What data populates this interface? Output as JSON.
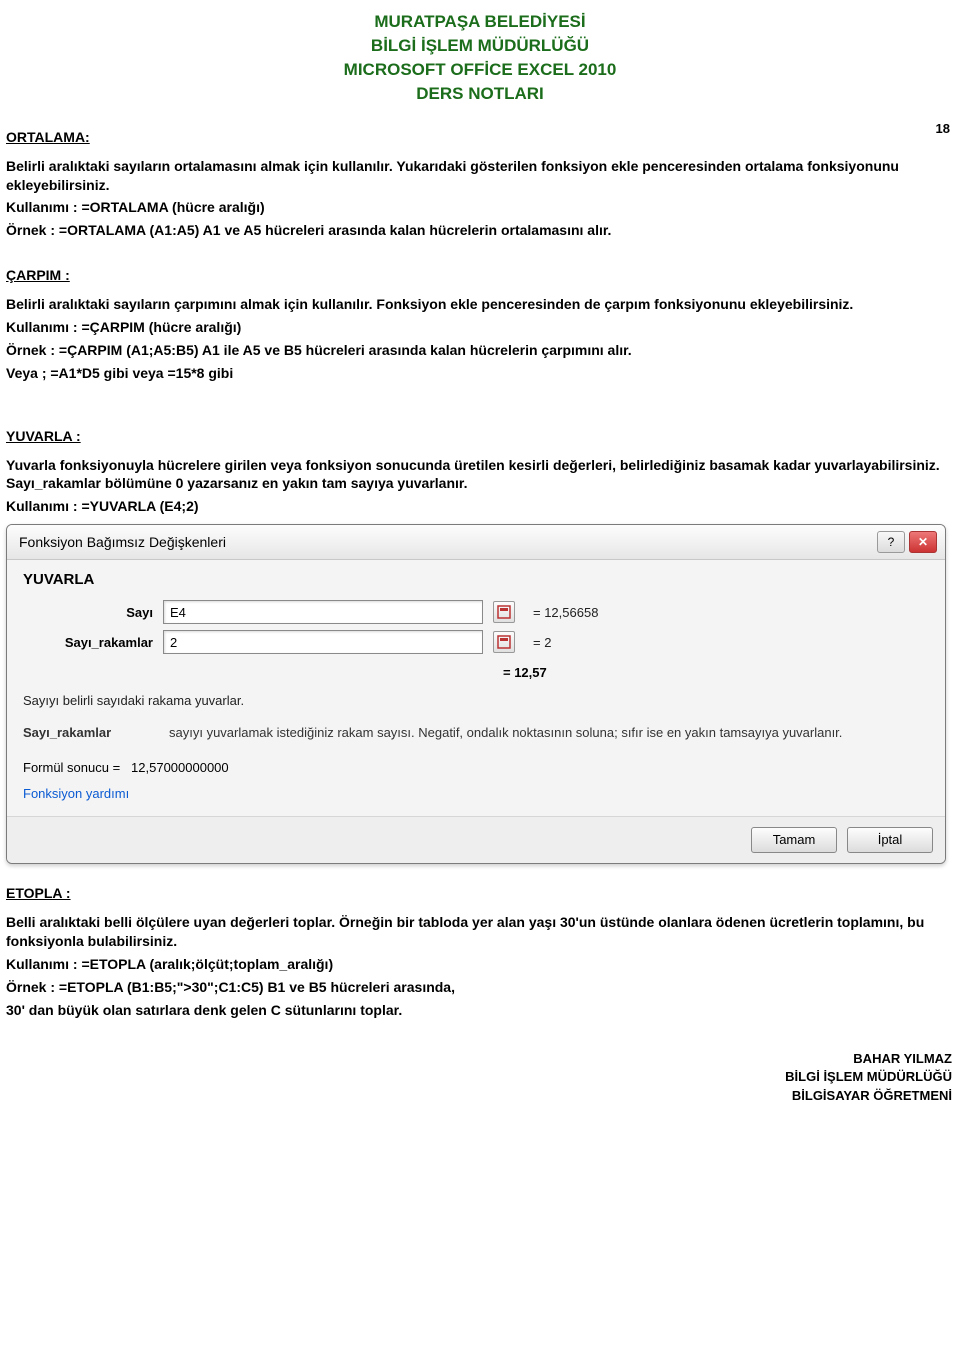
{
  "header": {
    "lines": [
      "MURATPAŞA BELEDİYESİ",
      "BİLGİ İŞLEM MÜDÜRLÜĞÜ",
      "MICROSOFT OFFİCE EXCEL 2010",
      "DERS NOTLARI"
    ]
  },
  "page_number": "18",
  "sections": {
    "ortalama": {
      "title": "ORTALAMA:",
      "p1": "Belirli aralıktaki sayıların ortalamasını almak için kullanılır. Yukarıdaki gösterilen fonksiyon ekle penceresinden ortalama fonksiyonunu ekleyebilirsiniz.",
      "p2": "Kullanımı : =ORTALAMA (hücre aralığı)",
      "p3": "Örnek : =ORTALAMA (A1:A5) A1 ve A5 hücreleri arasında kalan hücrelerin ortalamasını alır."
    },
    "carpim": {
      "title": "ÇARPIM :",
      "p1": "Belirli aralıktaki sayıların çarpımını almak için kullanılır. Fonksiyon ekle penceresinden de çarpım fonksiyonunu ekleyebilirsiniz.",
      "p2": "Kullanımı : =ÇARPIM (hücre aralığı)",
      "p3": "Örnek : =ÇARPIM (A1;A5:B5) A1 ile A5 ve B5 hücreleri arasında kalan hücrelerin çarpımını alır.",
      "p4": "Veya ; =A1*D5 gibi veya =15*8 gibi"
    },
    "yuvarla": {
      "title": "YUVARLA :",
      "p1": "Yuvarla fonksiyonuyla hücrelere girilen veya fonksiyon sonucunda üretilen kesirli değerleri, belirlediğiniz basamak kadar yuvarlayabilirsiniz. Sayı_rakamlar bölümüne 0 yazarsanız en yakın tam sayıya yuvarlanır.",
      "p2": "Kullanımı : =YUVARLA (E4;2)"
    },
    "etopla": {
      "title": "ETOPLA :",
      "p1": "Belli aralıktaki belli ölçülere uyan değerleri toplar. Örneğin bir tabloda yer alan yaşı 30'un üstünde olanlara ödenen ücretlerin toplamını, bu fonksiyonla bulabilirsiniz.",
      "p2": "Kullanımı : =ETOPLA (aralık;ölçüt;toplam_aralığı)",
      "p3": "Örnek : =ETOPLA (B1:B5;\">30\";C1:C5) B1 ve B5 hücreleri arasında,",
      "p4": "30' dan büyük olan satırlara denk gelen C sütunlarını toplar."
    }
  },
  "dialog": {
    "title": "Fonksiyon Bağımsız Değişkenleri",
    "help_icon": "?",
    "close_icon": "✕",
    "func_name": "YUVARLA",
    "arg1": {
      "label": "Sayı",
      "value": "E4",
      "result": "=  12,56658"
    },
    "arg2": {
      "label": "Sayı_rakamlar",
      "value": "2",
      "result": "=  2"
    },
    "eq_result": "=  12,57",
    "desc1": "Sayıyı belirli sayıdaki rakama yuvarlar.",
    "desc2_label": "Sayı_rakamlar",
    "desc2_text": "sayıyı yuvarlamak istediğiniz rakam sayısı. Negatif, ondalık noktasının soluna; sıfır ise en yakın tamsayıya yuvarlanır.",
    "formula_result_label": "Formül sonucu =",
    "formula_result_value": "12,57000000000",
    "help_link": "Fonksiyon yardımı",
    "ok_button": "Tamam",
    "cancel_button": "İptal"
  },
  "footer": {
    "lines": [
      "BAHAR YILMAZ",
      "BİLGİ İŞLEM MÜDÜRLÜĞÜ",
      "BİLGİSAYAR ÖĞRETMENİ"
    ]
  }
}
